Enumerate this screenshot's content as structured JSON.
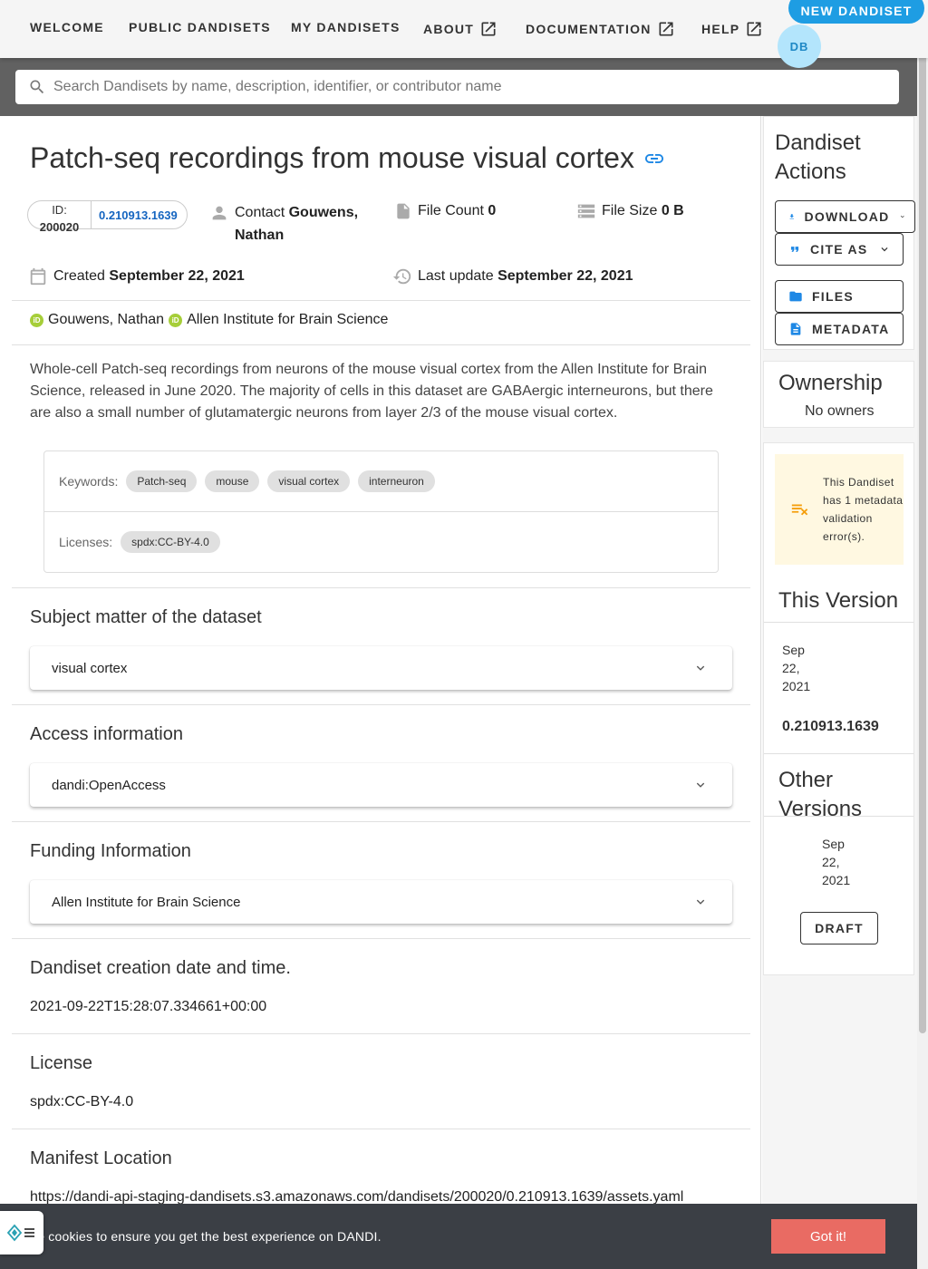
{
  "nav": {
    "welcome": "WELCOME",
    "public": "PUBLIC DANDISETS",
    "my": "MY DANDISETS",
    "about": "ABOUT",
    "docs": "DOCUMENTATION",
    "help": "HELP",
    "new_dandiset": "NEW DANDISET",
    "avatar": "DB"
  },
  "search": {
    "placeholder": "Search Dandisets by name, description, identifier, or contributor name"
  },
  "dandiset": {
    "title": "Patch-seq recordings from mouse visual cortex",
    "id_label": "ID:",
    "id": "200020",
    "version": "0.210913.1639",
    "contact_label": "Contact",
    "contact": "Gouwens, Nathan",
    "file_count_label": "File Count",
    "file_count": "0",
    "file_size_label": "File Size",
    "file_size": "0 B",
    "created_label": "Created",
    "created": "September 22, 2021",
    "updated_label": "Last update",
    "updated": "September 22, 2021",
    "contributors": [
      "Gouwens, Nathan",
      "Allen Institute for Brain Science"
    ],
    "orcid_mark": "iD",
    "description": "Whole-cell Patch-seq recordings from neurons of the mouse visual cortex from the Allen Institute for Brain Science, released in June 2020. The majority of cells in this dataset are GABAergic interneurons, but there are also a small number of glutamatergic neurons from layer 2/3 of the mouse visual cortex.",
    "keywords_label": "Keywords:",
    "keywords": [
      "Patch-seq",
      "mouse",
      "visual cortex",
      "interneuron"
    ],
    "licenses_label": "Licenses:",
    "licenses": [
      "spdx:CC-BY-4.0"
    ]
  },
  "sections": {
    "subject_title": "Subject matter of the dataset",
    "subject_value": "visual cortex",
    "access_title": "Access information",
    "access_value": "dandi:OpenAccess",
    "funding_title": "Funding Information",
    "funding_value": "Allen Institute for Brain Science",
    "creation_title": "Dandiset creation date and time.",
    "creation_value": "2021-09-22T15:28:07.334661+00:00",
    "license_title": "License",
    "license_value": "spdx:CC-BY-4.0",
    "manifest_title": "Manifest Location",
    "manifest_value": "https://dandi-api-staging-dandisets.s3.amazonaws.com/dandisets/200020/0.210913.1639/assets.yaml"
  },
  "sidebar": {
    "actions_title": "Dandiset Actions",
    "download": "DOWNLOAD",
    "cite": "CITE AS",
    "files": "FILES",
    "metadata": "METADATA",
    "ownership_title": "Ownership",
    "owners": "No owners",
    "warning": "This Dandiset has 1 metadata validation error(s).",
    "this_version_title": "This Version",
    "this_version_date": "Sep 22, 2021",
    "this_version_id": "0.210913.1639",
    "other_versions_title": "Other Versions",
    "other_version_date": "Sep 22, 2021",
    "draft": "DRAFT"
  },
  "cookie": {
    "text": "se cookies to ensure you get the best experience on DANDI.",
    "button": "Got it!"
  },
  "colors": {
    "accent": "#1e9de3",
    "link": "#1565c0",
    "cookie_button": "#e96b63",
    "warning_bg": "#fff8e1",
    "warning_icon": "#f59e0b"
  }
}
